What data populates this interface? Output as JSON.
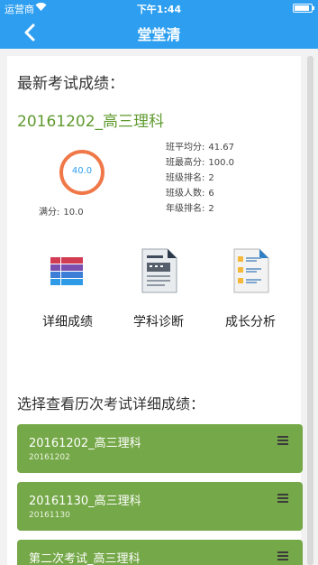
{
  "status_bar": {
    "carrier": "运营商",
    "time": "下午1:44"
  },
  "nav": {
    "title": "堂堂清"
  },
  "latest": {
    "section_title": "最新考试成绩：",
    "exam_name": "20161202_高三理科",
    "score": "40.0",
    "full_label": "满分:",
    "full_value": "10.0",
    "stats": [
      {
        "label": "班平均分:",
        "value": "41.67"
      },
      {
        "label": "班最高分:",
        "value": "100.0"
      },
      {
        "label": "班级排名:",
        "value": "2"
      },
      {
        "label": "班级人数:",
        "value": "6"
      },
      {
        "label": "年级排名:",
        "value": "2"
      }
    ]
  },
  "functions": [
    {
      "label": "详细成绩",
      "icon": "grid-table-icon"
    },
    {
      "label": "学科诊断",
      "icon": "document-icon"
    },
    {
      "label": "成长分析",
      "icon": "analysis-report-icon"
    }
  ],
  "history": {
    "section_title": "选择查看历次考试详细成绩：",
    "items": [
      {
        "name": "20161202_高三理科",
        "sub": "20161202"
      },
      {
        "name": "20161130_高三理科",
        "sub": "20161130"
      },
      {
        "name": "第二次考试_高三理科",
        "sub": ""
      }
    ]
  },
  "colors": {
    "primary": "#2e9ff0",
    "green": "#75a848",
    "ring": "#f07848"
  }
}
